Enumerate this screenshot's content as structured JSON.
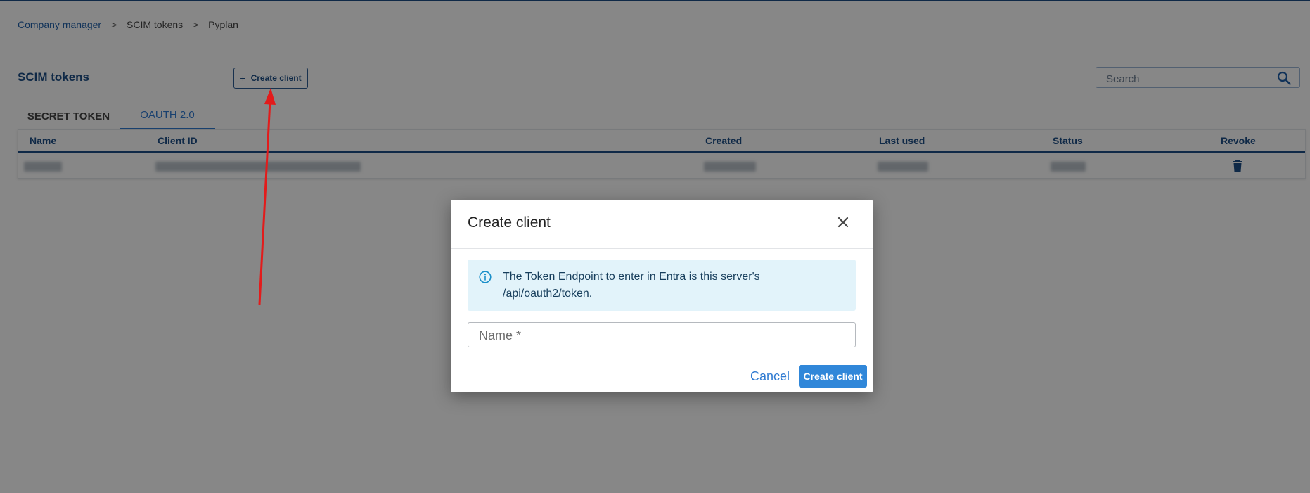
{
  "breadcrumb": {
    "items": [
      "Company manager",
      "SCIM tokens",
      "Pyplan"
    ],
    "separator": ">"
  },
  "page": {
    "title": "SCIM tokens",
    "create_button_label": "Create client",
    "create_button_icon": "+"
  },
  "search": {
    "placeholder": "Search",
    "icon": "search-icon"
  },
  "tabs": [
    {
      "label": "SECRET TOKEN",
      "active": false
    },
    {
      "label": "OAUTH 2.0",
      "active": true
    }
  ],
  "table": {
    "columns": [
      "Name",
      "Client ID",
      "Created",
      "Last used",
      "Status",
      "Revoke"
    ],
    "rows": [
      {
        "name": "",
        "client_id": "",
        "created": "",
        "last_used": "",
        "status": "",
        "revoke_icon": "trash-icon"
      }
    ]
  },
  "modal": {
    "title": "Create client",
    "close_icon": "close-icon",
    "info_icon": "info-icon",
    "info_text": "The Token Endpoint to enter in Entra is this server's /api/oauth2/token.",
    "name_placeholder": "Name *",
    "name_value": "",
    "cancel_label": "Cancel",
    "submit_label": "Create client"
  },
  "colors": {
    "accent": "#2f7ad1",
    "navy": "#1e4f86",
    "info_bg": "#e2f3fa",
    "annotation": "#e31b1b"
  }
}
